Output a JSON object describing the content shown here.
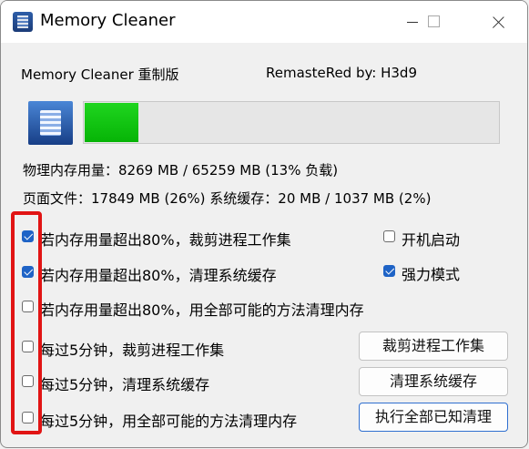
{
  "window": {
    "title": "Memory Cleaner"
  },
  "header": {
    "left": "Memory Cleaner 重制版",
    "right": "RemasteRed by: H3d9"
  },
  "memory": {
    "usage_percent": 13
  },
  "stats": {
    "physical": "物理内存用量：8269 MB  /  65259 MB  (13% 负载)",
    "pagefile": "页面文件：17849 MB (26%)    系统缓存：20 MB / 1037 MB  (2%)"
  },
  "options": [
    {
      "label": "若内存用量超出80%，裁剪进程工作集",
      "checked": true
    },
    {
      "label": "若内存用量超出80%，清理系统缓存",
      "checked": true
    },
    {
      "label": "若内存用量超出80%，用全部可能的方法清理内存",
      "checked": false
    },
    {
      "label": "每过5分钟，裁剪进程工作集",
      "checked": false
    },
    {
      "label": "每过5分钟，清理系统缓存",
      "checked": false
    },
    {
      "label": "每过5分钟，用全部可能的方法清理内存",
      "checked": false
    }
  ],
  "side_options": [
    {
      "label": "开机启动",
      "checked": false
    },
    {
      "label": "强力模式",
      "checked": true
    }
  ],
  "buttons": {
    "trim": "裁剪进程工作集",
    "clean_cache": "清理系统缓存",
    "clean_all": "执行全部已知清理"
  },
  "colors": {
    "progress": "#10c410",
    "accent": "#1e63c6",
    "highlight": "#e11414"
  }
}
